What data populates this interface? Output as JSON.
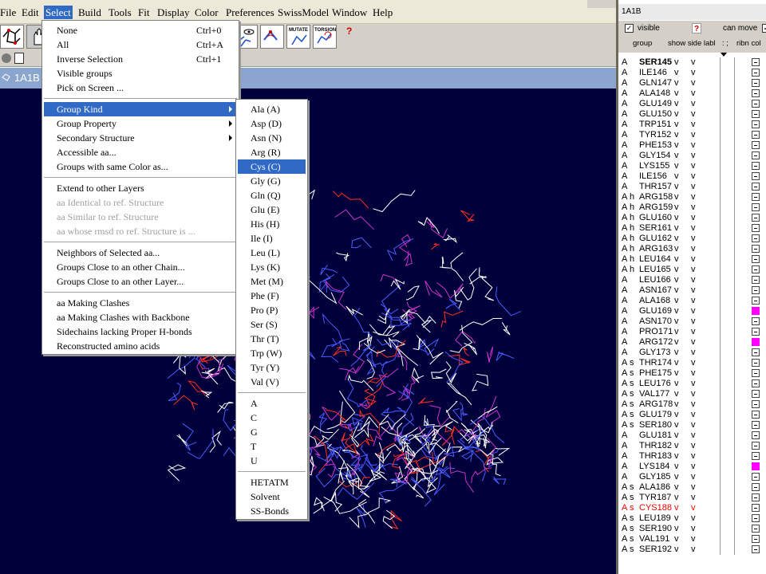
{
  "menubar": {
    "items": [
      "File",
      "Edit",
      "Select",
      "Build",
      "Tools",
      "Fit",
      "Display",
      "Color",
      "Preferences",
      "SwissModel",
      "Window",
      "Help"
    ],
    "active": "Select"
  },
  "toolbar": {
    "mutate_label": "MUTATE",
    "torsion_label": "TORSION",
    "help_glyph": "?"
  },
  "viewer": {
    "title": "1A1B"
  },
  "select_menu": {
    "items": [
      {
        "label": "None",
        "shortcut": "Ctrl+0"
      },
      {
        "label": "All",
        "shortcut": "Ctrl+A"
      },
      {
        "label": "Inverse Selection",
        "shortcut": "Ctrl+1"
      },
      {
        "label": "Visible groups"
      },
      {
        "label": "Pick on Screen ..."
      },
      {
        "label": "Group Kind",
        "submenu": true,
        "selected": true
      },
      {
        "label": "Group Property",
        "submenu": true
      },
      {
        "label": "Secondary Structure",
        "submenu": true
      },
      {
        "label": "Accessible aa..."
      },
      {
        "label": "Groups with same Color as..."
      },
      {
        "label": "Extend to other Layers"
      },
      {
        "label": "aa Identical to ref. Structure",
        "disabled": true
      },
      {
        "label": "aa Similar to ref. Structure",
        "disabled": true
      },
      {
        "label": "aa whose rmsd ro ref. Structure is ...",
        "disabled": true
      },
      {
        "label": "Neighbors of Selected aa..."
      },
      {
        "label": "Groups Close to an other Chain..."
      },
      {
        "label": "Groups Close to an other Layer..."
      },
      {
        "label": "aa Making Clashes"
      },
      {
        "label": "aa Making Clashes with Backbone"
      },
      {
        "label": "Sidechains lacking Proper H-bonds"
      },
      {
        "label": "Reconstructed amino acids"
      }
    ]
  },
  "group_kind_menu": {
    "items": [
      {
        "label": "Ala (A)"
      },
      {
        "label": "Asp (D)"
      },
      {
        "label": "Asn (N)"
      },
      {
        "label": "Arg (R)"
      },
      {
        "label": "Cys (C)",
        "selected": true
      },
      {
        "label": "Gly (G)"
      },
      {
        "label": "Gln (Q)"
      },
      {
        "label": "Glu (E)"
      },
      {
        "label": "His (H)"
      },
      {
        "label": "Ile (I)"
      },
      {
        "label": "Leu (L)"
      },
      {
        "label": "Lys (K)"
      },
      {
        "label": "Met (M)"
      },
      {
        "label": "Phe (F)"
      },
      {
        "label": "Pro (P)"
      },
      {
        "label": "Ser (S)"
      },
      {
        "label": "Thr (T)"
      },
      {
        "label": "Trp (W)"
      },
      {
        "label": "Tyr (Y)"
      },
      {
        "label": "Val (V)"
      },
      {
        "label": "A"
      },
      {
        "label": "C"
      },
      {
        "label": "G"
      },
      {
        "label": "T"
      },
      {
        "label": "U"
      },
      {
        "label": "HETATM"
      },
      {
        "label": "Solvent"
      },
      {
        "label": "SS-Bonds"
      }
    ]
  },
  "control_panel": {
    "title": "1A1B",
    "visible_label": "visible",
    "can_move_label": "can move",
    "check_mark": "✓",
    "question_glyph": "?",
    "headers": {
      "group": "group",
      "show_side": "show side labl",
      "col3": ": ;",
      "ribn_col": "ribn col"
    },
    "rows": [
      {
        "chain": "A",
        "ss": "",
        "name": "SER145",
        "v1": "v",
        "v2": "v",
        "bold": true
      },
      {
        "chain": "A",
        "ss": "",
        "name": "ILE146",
        "v1": "v",
        "v2": "v"
      },
      {
        "chain": "A",
        "ss": "",
        "name": "GLN147",
        "v1": "v",
        "v2": "v"
      },
      {
        "chain": "A",
        "ss": "",
        "name": "ALA148",
        "v1": "v",
        "v2": "v"
      },
      {
        "chain": "A",
        "ss": "",
        "name": "GLU149",
        "v1": "v",
        "v2": "v"
      },
      {
        "chain": "A",
        "ss": "",
        "name": "GLU150",
        "v1": "v",
        "v2": "v"
      },
      {
        "chain": "A",
        "ss": "",
        "name": "TRP151",
        "v1": "v",
        "v2": "v"
      },
      {
        "chain": "A",
        "ss": "",
        "name": "TYR152",
        "v1": "v",
        "v2": "v"
      },
      {
        "chain": "A",
        "ss": "",
        "name": "PHE153",
        "v1": "v",
        "v2": "v"
      },
      {
        "chain": "A",
        "ss": "",
        "name": "GLY154",
        "v1": "v",
        "v2": "v"
      },
      {
        "chain": "A",
        "ss": "",
        "name": "LYS155",
        "v1": "v",
        "v2": "v"
      },
      {
        "chain": "A",
        "ss": "",
        "name": "ILE156",
        "v1": "v",
        "v2": "v"
      },
      {
        "chain": "A",
        "ss": "",
        "name": "THR157",
        "v1": "v",
        "v2": "v"
      },
      {
        "chain": "A",
        "ss": "h",
        "name": "ARG158",
        "v1": "v",
        "v2": "v"
      },
      {
        "chain": "A",
        "ss": "h",
        "name": "ARG159",
        "v1": "v",
        "v2": "v"
      },
      {
        "chain": "A",
        "ss": "h",
        "name": "GLU160",
        "v1": "v",
        "v2": "v"
      },
      {
        "chain": "A",
        "ss": "h",
        "name": "SER161",
        "v1": "v",
        "v2": "v"
      },
      {
        "chain": "A",
        "ss": "h",
        "name": "GLU162",
        "v1": "v",
        "v2": "v"
      },
      {
        "chain": "A",
        "ss": "h",
        "name": "ARG163",
        "v1": "v",
        "v2": "v"
      },
      {
        "chain": "A",
        "ss": "h",
        "name": "LEU164",
        "v1": "v",
        "v2": "v"
      },
      {
        "chain": "A",
        "ss": "h",
        "name": "LEU165",
        "v1": "v",
        "v2": "v"
      },
      {
        "chain": "A",
        "ss": "",
        "name": "LEU166",
        "v1": "v",
        "v2": "v"
      },
      {
        "chain": "A",
        "ss": "",
        "name": "ASN167",
        "v1": "v",
        "v2": "v"
      },
      {
        "chain": "A",
        "ss": "",
        "name": "ALA168",
        "v1": "v",
        "v2": "v"
      },
      {
        "chain": "A",
        "ss": "",
        "name": "GLU169",
        "v1": "v",
        "v2": "v",
        "magenta": true
      },
      {
        "chain": "A",
        "ss": "",
        "name": "ASN170",
        "v1": "v",
        "v2": "v"
      },
      {
        "chain": "A",
        "ss": "",
        "name": "PRO171",
        "v1": "v",
        "v2": "v"
      },
      {
        "chain": "A",
        "ss": "",
        "name": "ARG172",
        "v1": "v",
        "v2": "v",
        "magenta": true
      },
      {
        "chain": "A",
        "ss": "",
        "name": "GLY173",
        "v1": "v",
        "v2": "v"
      },
      {
        "chain": "A",
        "ss": "s",
        "name": "THR174",
        "v1": "v",
        "v2": "v"
      },
      {
        "chain": "A",
        "ss": "s",
        "name": "PHE175",
        "v1": "v",
        "v2": "v"
      },
      {
        "chain": "A",
        "ss": "s",
        "name": "LEU176",
        "v1": "v",
        "v2": "v"
      },
      {
        "chain": "A",
        "ss": "s",
        "name": "VAL177",
        "v1": "v",
        "v2": "v"
      },
      {
        "chain": "A",
        "ss": "s",
        "name": "ARG178",
        "v1": "v",
        "v2": "v"
      },
      {
        "chain": "A",
        "ss": "s",
        "name": "GLU179",
        "v1": "v",
        "v2": "v"
      },
      {
        "chain": "A",
        "ss": "s",
        "name": "SER180",
        "v1": "v",
        "v2": "v"
      },
      {
        "chain": "A",
        "ss": "",
        "name": "GLU181",
        "v1": "v",
        "v2": "v"
      },
      {
        "chain": "A",
        "ss": "",
        "name": "THR182",
        "v1": "v",
        "v2": "v"
      },
      {
        "chain": "A",
        "ss": "",
        "name": "THR183",
        "v1": "v",
        "v2": "v"
      },
      {
        "chain": "A",
        "ss": "",
        "name": "LYS184",
        "v1": "v",
        "v2": "v",
        "magenta": true
      },
      {
        "chain": "A",
        "ss": "",
        "name": "GLY185",
        "v1": "v",
        "v2": "v"
      },
      {
        "chain": "A",
        "ss": "s",
        "name": "ALA186",
        "v1": "v",
        "v2": "v"
      },
      {
        "chain": "A",
        "ss": "s",
        "name": "TYR187",
        "v1": "v",
        "v2": "v"
      },
      {
        "chain": "A",
        "ss": "s",
        "name": "CYS188",
        "v1": "v",
        "v2": "v",
        "red": true
      },
      {
        "chain": "A",
        "ss": "s",
        "name": "LEU189",
        "v1": "v",
        "v2": "v"
      },
      {
        "chain": "A",
        "ss": "s",
        "name": "SER190",
        "v1": "v",
        "v2": "v"
      },
      {
        "chain": "A",
        "ss": "s",
        "name": "VAL191",
        "v1": "v",
        "v2": "v"
      },
      {
        "chain": "A",
        "ss": "s",
        "name": "SER192",
        "v1": "v",
        "v2": "v"
      }
    ]
  },
  "colors": {
    "accent": "#316ac5",
    "viewer_bg": "#00003a",
    "selected_residue": "#ff00ff",
    "red_residue": "#ee0000"
  }
}
